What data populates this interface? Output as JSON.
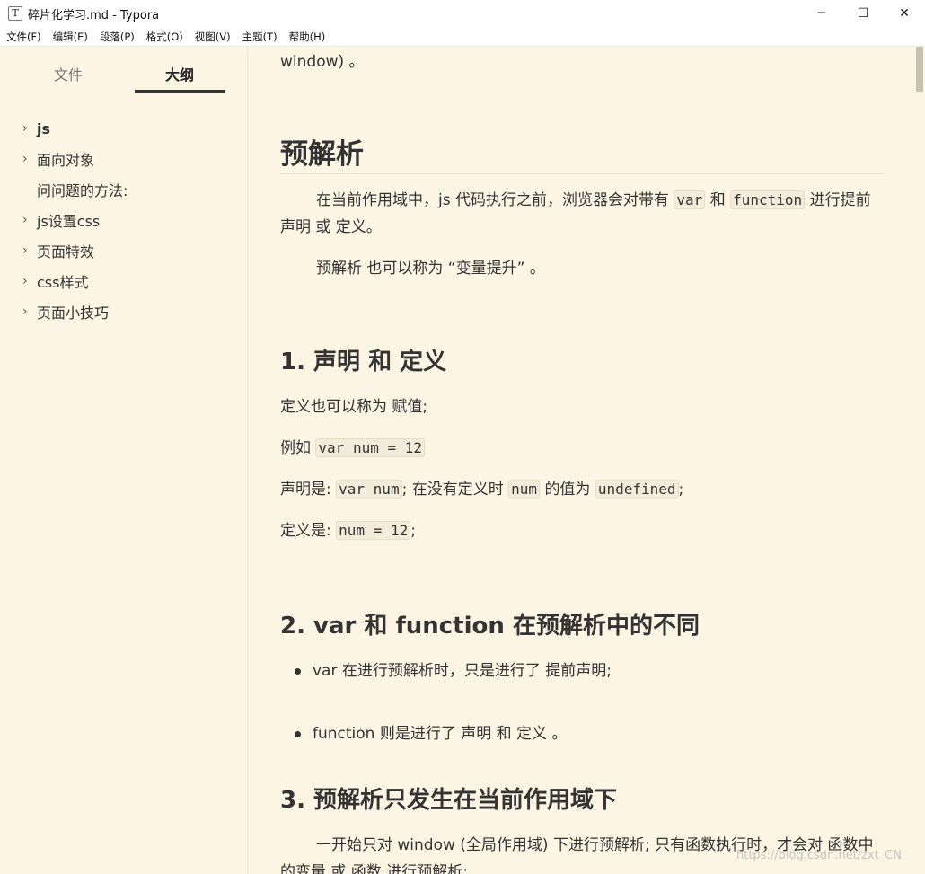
{
  "window": {
    "app_icon": "T",
    "title": "碎片化学习.md - Typora",
    "minimize": "─",
    "maximize": "☐",
    "close": "✕"
  },
  "menu": [
    "文件(F)",
    "编辑(E)",
    "段落(P)",
    "格式(O)",
    "视图(V)",
    "主题(T)",
    "帮助(H)"
  ],
  "sidebar": {
    "tab_files": "文件",
    "tab_outline": "大纲",
    "items": [
      {
        "label": "js",
        "has_arrow": true,
        "bold": true
      },
      {
        "label": "面向对象",
        "has_arrow": true,
        "bold": false
      },
      {
        "label": "问问题的方法:",
        "has_arrow": false,
        "bold": false
      },
      {
        "label": "js设置css",
        "has_arrow": true,
        "bold": false
      },
      {
        "label": "页面特效",
        "has_arrow": true,
        "bold": false
      },
      {
        "label": "css样式",
        "has_arrow": true,
        "bold": false
      },
      {
        "label": "页面小技巧",
        "has_arrow": true,
        "bold": false
      }
    ]
  },
  "doc": {
    "p0": "window) 。",
    "h1": "预解析",
    "p1_a": "在当前作用域中，js 代码执行之前，浏览器会对带有",
    "p1_code1": "var",
    "p1_b": "和",
    "p1_code2": "function",
    "p1_c": "进行提前声明 或 定义。",
    "p2": "预解析 也可以称为 “变量提升” 。",
    "h2_1": "1. 声明 和 定义",
    "p3": "定义也可以称为 赋值;",
    "p4_a": "例如",
    "p4_code": "var num = 12",
    "p5_a": "声明是: ",
    "p5_code1": "var num",
    "p5_b": "; 在没有定义时",
    "p5_code2": "num",
    "p5_c": "的值为",
    "p5_code3": "undefined",
    "p5_d": ";",
    "p6_a": "定义是: ",
    "p6_code": "num = 12",
    "p6_b": ";",
    "h2_2": "2. var  和 function 在预解析中的不同",
    "li1": "var 在进行预解析时，只是进行了 提前声明;",
    "li2": "function 则是进行了 声明 和 定义 。",
    "h2_3": "3. 预解析只发生在当前作用域下",
    "p7": "一开始只对 window (全局作用域) 下进行预解析; 只有函数执行时，才会对 函数中的变量 或 函数 进行预解析;"
  },
  "watermark": "https://blog.csdn.net/zxt_CN"
}
